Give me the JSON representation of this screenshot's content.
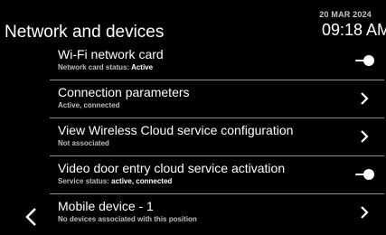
{
  "header": {
    "title": "Network and devices",
    "date": "20 MAR 2024",
    "time": "09:18 AM"
  },
  "rows": [
    {
      "title": "Wi-Fi network card",
      "subtitle_prefix": "Network card status: ",
      "subtitle_value": "Active",
      "control": "toggle",
      "toggle_state": "on"
    },
    {
      "title": "Connection parameters",
      "subtitle_prefix": "Active, connected",
      "subtitle_value": "",
      "control": "chevron"
    },
    {
      "title": "View Wireless Cloud service configuration",
      "subtitle_prefix": "Not associated",
      "subtitle_value": "",
      "control": "chevron"
    },
    {
      "title": "Video door entry cloud service activation",
      "subtitle_prefix": "Service status: ",
      "subtitle_value": "active, connected",
      "control": "toggle",
      "toggle_state": "on"
    },
    {
      "title": "Mobile device - 1",
      "subtitle_prefix": "No devices associated with this position",
      "subtitle_value": "",
      "control": "chevron"
    }
  ],
  "colors": {
    "background": "#000000",
    "text": "#ffffff",
    "subtitle": "#bdbdbd",
    "divider": "#8f8f8f",
    "toggle_knob": "#ffffff"
  },
  "icons": {
    "back": "chevron-left-icon",
    "row_action": "chevron-right-icon",
    "switch": "toggle-switch-icon"
  }
}
